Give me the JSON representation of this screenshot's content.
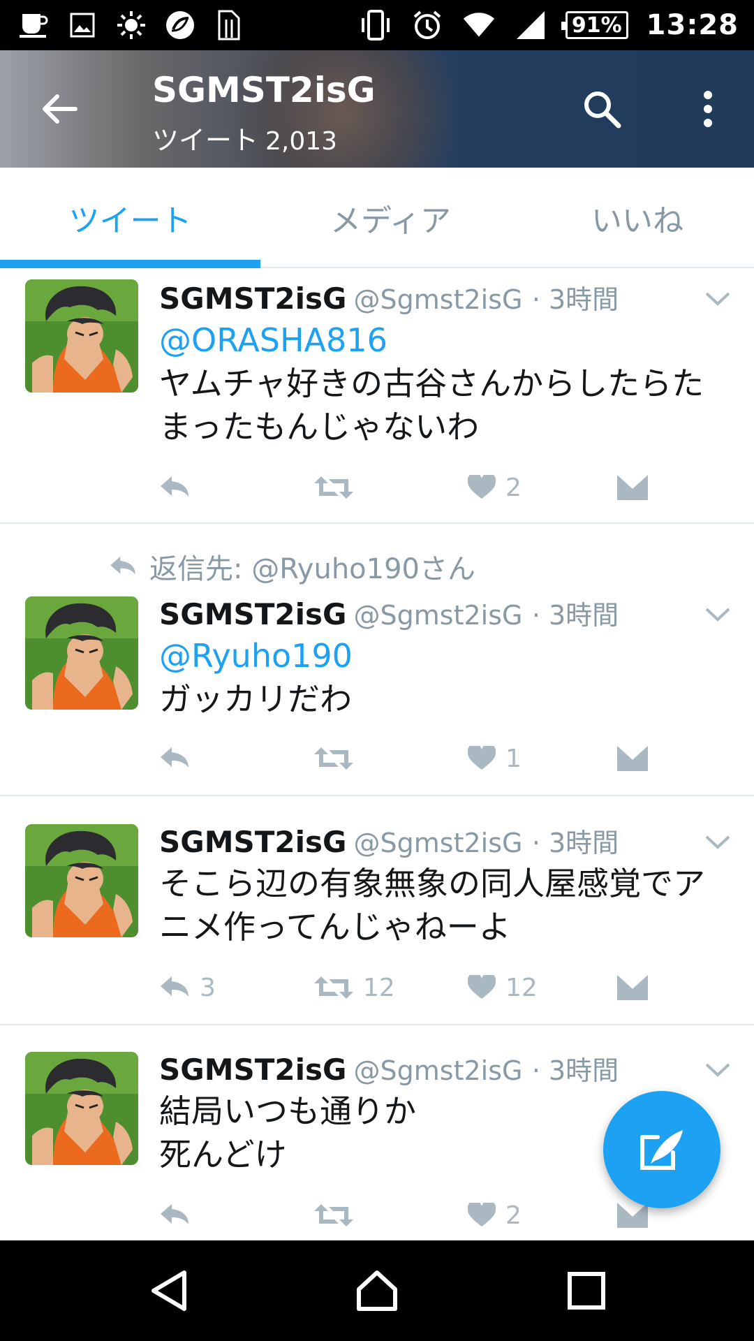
{
  "status_bar": {
    "battery": "91%",
    "time": "13:28",
    "left_icons": [
      "cup-icon",
      "image-icon",
      "brightness-icon",
      "sync-icon",
      "sim-icon"
    ],
    "right_icons": [
      "vibrate-icon",
      "alarm-icon",
      "wifi-icon",
      "signal-icon",
      "battery-icon"
    ]
  },
  "header": {
    "title": "SGMST2isG",
    "subtitle_label": "ツイート",
    "tweet_count": "2,013"
  },
  "tabs": [
    {
      "label": "ツイート",
      "active": true
    },
    {
      "label": "メディア",
      "active": false
    },
    {
      "label": "いいね",
      "active": false
    }
  ],
  "tweets": [
    {
      "name": "SGMST2isG",
      "handle": "@Sgmst2isG",
      "time": "· 3時間",
      "mention": "@ORASHA816",
      "lines": [
        "ヤムチャ好きの古谷さんからしたらた",
        "まったもんじゃないわ"
      ],
      "reply_count": "",
      "retweet_count": "",
      "like_count": "2"
    },
    {
      "reply_to_label": "返信先:",
      "reply_to_user": "@Ryuho190さん",
      "name": "SGMST2isG",
      "handle": "@Sgmst2isG",
      "time": "· 3時間",
      "mention": "@Ryuho190",
      "lines": [
        "ガッカリだわ"
      ],
      "reply_count": "",
      "retweet_count": "",
      "like_count": "1"
    },
    {
      "name": "SGMST2isG",
      "handle": "@Sgmst2isG",
      "time": "· 3時間",
      "lines": [
        "そこら辺の有象無象の同人屋感覚でア",
        "ニメ作ってんじゃねーよ"
      ],
      "reply_count": "3",
      "retweet_count": "12",
      "like_count": "12"
    },
    {
      "name": "SGMST2isG",
      "handle": "@Sgmst2isG",
      "time": "· 3時間",
      "lines": [
        "結局いつも通りか",
        "死んどけ"
      ],
      "reply_count": "",
      "retweet_count": "",
      "like_count": "2"
    }
  ],
  "colors": {
    "accent": "#1da1f2",
    "muted": "#8899a6",
    "icon_gray": "#aab8c2"
  }
}
